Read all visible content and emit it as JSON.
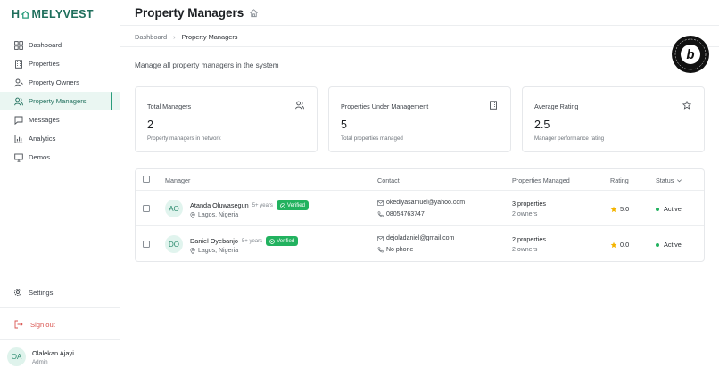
{
  "app": {
    "logo_left": "H",
    "logo_right": "MELYVEST"
  },
  "sidebar": {
    "items": [
      {
        "label": "Dashboard",
        "icon": "dashboard-icon"
      },
      {
        "label": "Properties",
        "icon": "building-icon"
      },
      {
        "label": "Property Owners",
        "icon": "user-key-icon"
      },
      {
        "label": "Property Managers",
        "icon": "users-icon",
        "active": true
      },
      {
        "label": "Messages",
        "icon": "message-icon"
      },
      {
        "label": "Analytics",
        "icon": "chart-icon"
      },
      {
        "label": "Demos",
        "icon": "monitor-icon"
      }
    ],
    "settings": "Settings",
    "signout": "Sign out",
    "user": {
      "initials": "OA",
      "name": "Olalekan Ajayi",
      "role": "Admin"
    }
  },
  "header": {
    "title": "Property Managers",
    "breadcrumb": {
      "home": "Dashboard",
      "current": "Property Managers"
    },
    "subtitle": "Manage all property managers in the system",
    "badge_letter": "b"
  },
  "cards": [
    {
      "label": "Total Managers",
      "value": "2",
      "desc": "Property managers in network",
      "icon": "users-icon"
    },
    {
      "label": "Properties Under Management",
      "value": "5",
      "desc": "Total properties managed",
      "icon": "building-icon"
    },
    {
      "label": "Average Rating",
      "value": "2.5",
      "desc": "Manager performance rating",
      "icon": "star-icon"
    }
  ],
  "table": {
    "headers": {
      "manager": "Manager",
      "contact": "Contact",
      "properties": "Properties Managed",
      "rating": "Rating",
      "status": "Status"
    },
    "rows": [
      {
        "initials": "AO",
        "name": "Atanda Oluwasegun",
        "years": "5+ years",
        "verified": "Verified",
        "location": "Lagos, Nigeria",
        "email": "okediyasamuel@yahoo.com",
        "phone": "08054763747",
        "properties": "3 properties",
        "owners": "2 owners",
        "rating": "5.0",
        "status": "Active"
      },
      {
        "initials": "DO",
        "name": "Daniel Oyebanjo",
        "years": "5+ years",
        "verified": "Verified",
        "location": "Lagos, Nigeria",
        "email": "dejoladaniel@gmail.com",
        "phone": "No phone",
        "properties": "2 properties",
        "owners": "2 owners",
        "rating": "0.0",
        "status": "Active"
      }
    ]
  },
  "colors": {
    "brand": "#1f6f5c",
    "accent": "#2a9d7c",
    "verified": "#22b25f",
    "danger": "#d9534f",
    "star": "#f4b400"
  }
}
